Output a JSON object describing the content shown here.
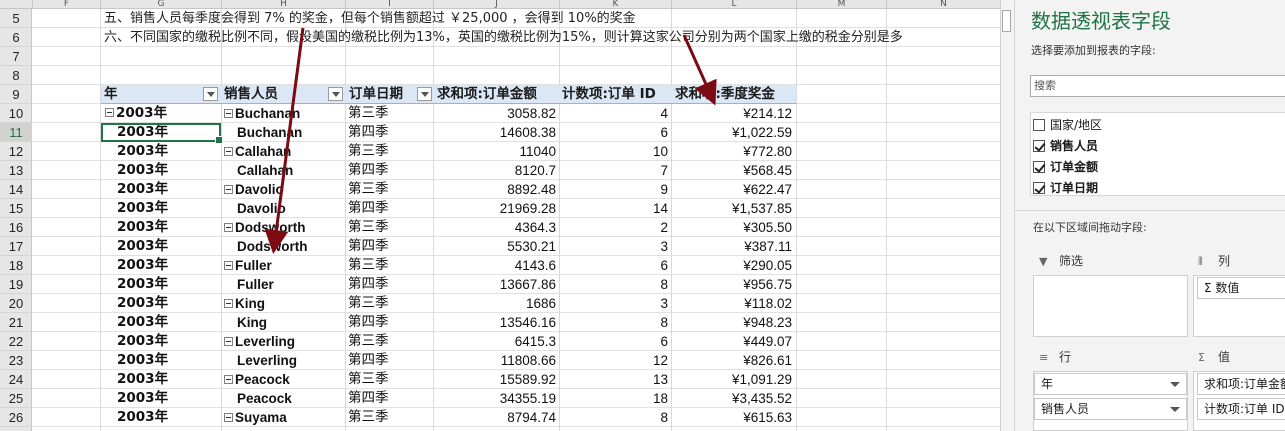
{
  "sheet": {
    "columns": [
      "F",
      "G",
      "H",
      "I",
      "J",
      "K",
      "L",
      "M",
      "N"
    ],
    "rows": [
      "5",
      "6",
      "7",
      "8",
      "9",
      "10",
      "11",
      "12",
      "13",
      "14",
      "15",
      "16",
      "17",
      "18",
      "19",
      "20",
      "21",
      "22",
      "23",
      "24",
      "25",
      "26"
    ],
    "selected_row": "11",
    "notes": [
      "五、销售人员每季度会得到 7% 的奖金，但每个销售额超过 ￥25,000 ，会得到 10%的奖金",
      "六、不同国家的缴税比例不同，假设美国的缴税比例为13%，英国的缴税比例为15%，则计算这家公司分别为两个国家上缴的税金分别是多"
    ]
  },
  "pivot": {
    "headers": [
      "年",
      "销售人员",
      "订单日期",
      "求和项:订单金额",
      "计数项:订单 ID",
      "求和项:季度奖金"
    ],
    "rows": [
      {
        "year": "2003年",
        "year_group": true,
        "person": "Buchanan",
        "person_group": true,
        "quarter": "第三季",
        "amount": "3058.82",
        "count": "4",
        "bonus": "¥214.12"
      },
      {
        "year": "2003年",
        "year_group": false,
        "person": "Buchanan",
        "person_group": false,
        "quarter": "第四季",
        "amount": "14608.38",
        "count": "6",
        "bonus": "¥1,022.59"
      },
      {
        "year": "2003年",
        "year_group": false,
        "person": "Callahan",
        "person_group": true,
        "quarter": "第三季",
        "amount": "11040",
        "count": "10",
        "bonus": "¥772.80"
      },
      {
        "year": "2003年",
        "year_group": false,
        "person": "Callahan",
        "person_group": false,
        "quarter": "第四季",
        "amount": "8120.7",
        "count": "7",
        "bonus": "¥568.45"
      },
      {
        "year": "2003年",
        "year_group": false,
        "person": "Davolio",
        "person_group": true,
        "quarter": "第三季",
        "amount": "8892.48",
        "count": "9",
        "bonus": "¥622.47"
      },
      {
        "year": "2003年",
        "year_group": false,
        "person": "Davolio",
        "person_group": false,
        "quarter": "第四季",
        "amount": "21969.28",
        "count": "14",
        "bonus": "¥1,537.85"
      },
      {
        "year": "2003年",
        "year_group": false,
        "person": "Dodsworth",
        "person_group": true,
        "quarter": "第三季",
        "amount": "4364.3",
        "count": "2",
        "bonus": "¥305.50"
      },
      {
        "year": "2003年",
        "year_group": false,
        "person": "Dodsworth",
        "person_group": false,
        "quarter": "第四季",
        "amount": "5530.21",
        "count": "3",
        "bonus": "¥387.11"
      },
      {
        "year": "2003年",
        "year_group": false,
        "person": "Fuller",
        "person_group": true,
        "quarter": "第三季",
        "amount": "4143.6",
        "count": "6",
        "bonus": "¥290.05"
      },
      {
        "year": "2003年",
        "year_group": false,
        "person": "Fuller",
        "person_group": false,
        "quarter": "第四季",
        "amount": "13667.86",
        "count": "8",
        "bonus": "¥956.75"
      },
      {
        "year": "2003年",
        "year_group": false,
        "person": "King",
        "person_group": true,
        "quarter": "第三季",
        "amount": "1686",
        "count": "3",
        "bonus": "¥118.02"
      },
      {
        "year": "2003年",
        "year_group": false,
        "person": "King",
        "person_group": false,
        "quarter": "第四季",
        "amount": "13546.16",
        "count": "8",
        "bonus": "¥948.23"
      },
      {
        "year": "2003年",
        "year_group": false,
        "person": "Leverling",
        "person_group": true,
        "quarter": "第三季",
        "amount": "6415.3",
        "count": "6",
        "bonus": "¥449.07"
      },
      {
        "year": "2003年",
        "year_group": false,
        "person": "Leverling",
        "person_group": false,
        "quarter": "第四季",
        "amount": "11808.66",
        "count": "12",
        "bonus": "¥826.61"
      },
      {
        "year": "2003年",
        "year_group": false,
        "person": "Peacock",
        "person_group": true,
        "quarter": "第三季",
        "amount": "15589.92",
        "count": "13",
        "bonus": "¥1,091.29"
      },
      {
        "year": "2003年",
        "year_group": false,
        "person": "Peacock",
        "person_group": false,
        "quarter": "第四季",
        "amount": "34355.19",
        "count": "18",
        "bonus": "¥3,435.52"
      },
      {
        "year": "2003年",
        "year_group": false,
        "person": "Suyama",
        "person_group": true,
        "quarter": "第三季",
        "amount": "8794.74",
        "count": "8",
        "bonus": "¥615.63"
      }
    ]
  },
  "field_pane": {
    "title": "数据透视表字段",
    "subtitle": "选择要添加到报表的字段:",
    "search_placeholder": "搜索",
    "fields": [
      {
        "label": "国家/地区",
        "checked": false
      },
      {
        "label": "销售人员",
        "checked": true
      },
      {
        "label": "订单金额",
        "checked": true
      },
      {
        "label": "订单日期",
        "checked": true
      }
    ],
    "drag_label": "在以下区域间拖动字段:",
    "areas": {
      "filter": "筛选",
      "columns": "列",
      "rows": "行",
      "values": "值"
    },
    "column_items": [
      "Σ 数值"
    ],
    "row_items": [
      "年",
      "销售人员"
    ],
    "value_items": [
      "求和项:订单金额",
      "计数项:订单 ID"
    ]
  },
  "colors": {
    "accent": "#217346",
    "arrow": "#7b0a12",
    "pivot_header": "#dbe7f5"
  }
}
